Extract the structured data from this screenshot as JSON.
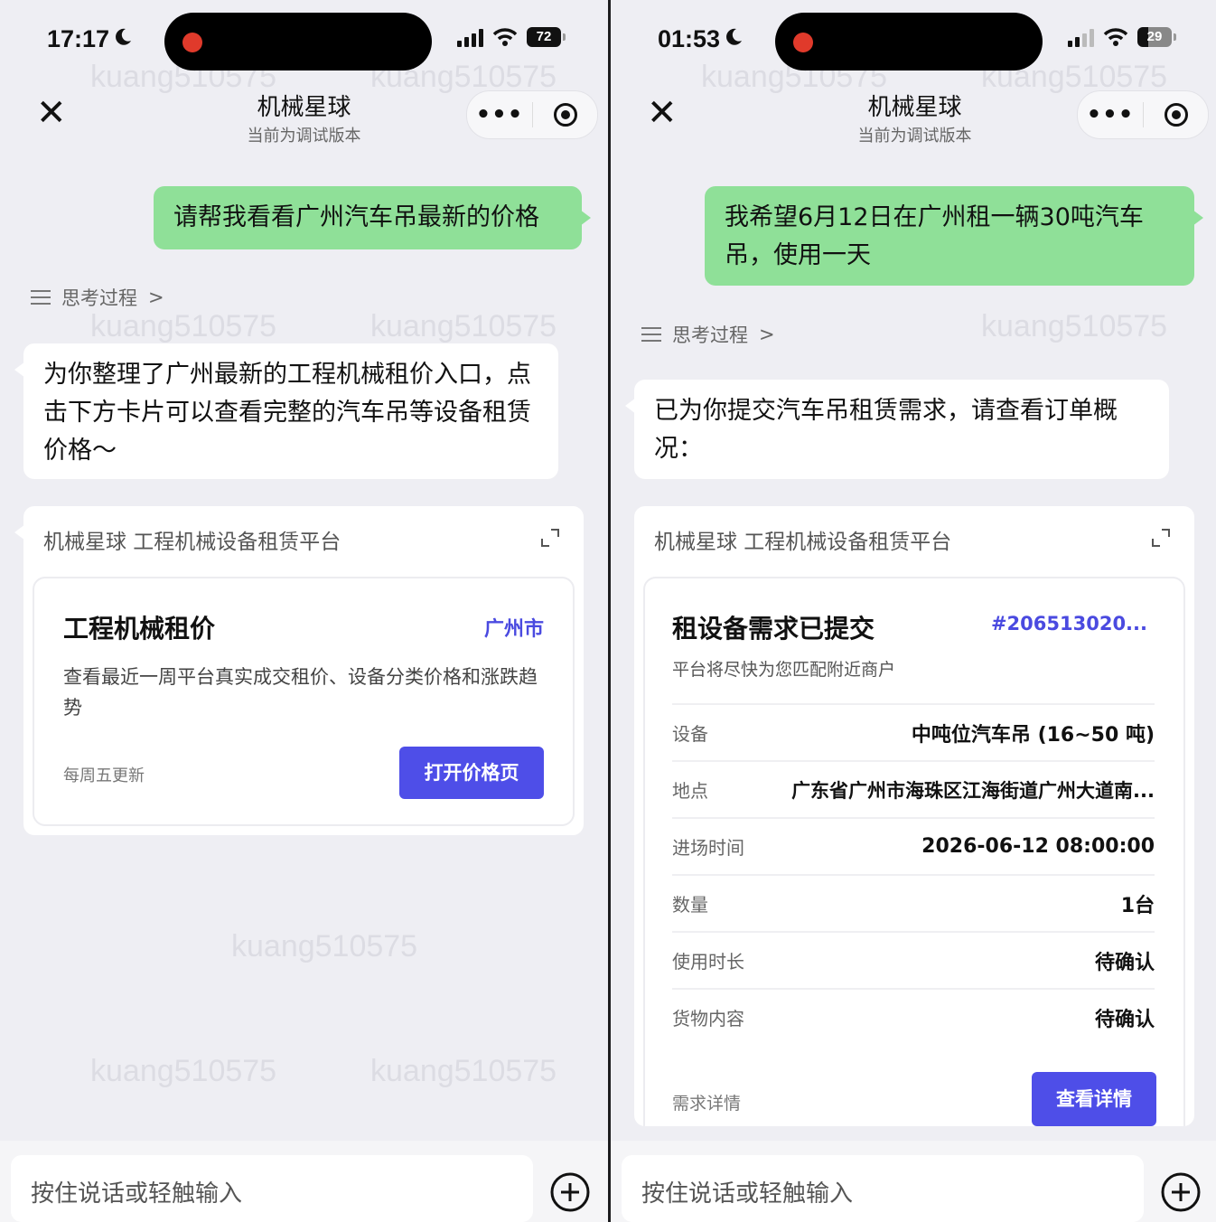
{
  "watermark": "kuang510575",
  "app": {
    "title": "机械星球",
    "subtitle": "当前为调试版本",
    "thinking_label": "思考过程",
    "thinking_chevron": ">",
    "card_header": "机械星球 工程机械设备租赁平台",
    "input_placeholder": "按住说话或轻触输入",
    "more_icon": "•••"
  },
  "left": {
    "status": {
      "time": "17:17",
      "battery": "72"
    },
    "user_message": "请帮我看看广州汽车吊最新的价格",
    "bot_message": "为你整理了广州最新的工程机械租价入口，点击下方卡片可以查看完整的汽车吊等设备租赁价格～",
    "card": {
      "title": "工程机械租价",
      "city": "广州市",
      "description": "查看最近一周平台真实成交租价、设备分类价格和涨跌趋势",
      "update_note": "每周五更新",
      "button": "打开价格页"
    }
  },
  "right": {
    "status": {
      "time": "01:53",
      "battery": "29"
    },
    "user_message": "我希望6月12日在广州租一辆30吨汽车吊，使用一天",
    "bot_message": "已为你提交汽车吊租赁需求，请查看订单概况：",
    "card": {
      "title": "租设备需求已提交",
      "order_id": "#206513020...",
      "subtitle": "平台将尽快为您匹配附近商户",
      "rows": [
        {
          "label": "设备",
          "value": "中吨位汽车吊 (16~50 吨)"
        },
        {
          "label": "地点",
          "value": "广东省广州市海珠区江海街道广州大道南..."
        },
        {
          "label": "进场时间",
          "value": "2026-06-12 08:00:00"
        },
        {
          "label": "数量",
          "value": "1台"
        },
        {
          "label": "使用时长",
          "value": "待确认"
        },
        {
          "label": "货物内容",
          "value": "待确认"
        }
      ],
      "footer_label": "需求详情",
      "button": "查看详情"
    }
  },
  "colors": {
    "user_bubble": "#8fe098",
    "accent": "#4e4ee8",
    "recording_dot": "#e03a2b"
  },
  "icons": [
    "close-icon",
    "more-icon",
    "record-icon",
    "menu-icon",
    "chevron-right-icon",
    "expand-icon",
    "plus-icon",
    "moon-icon",
    "signal-icon",
    "wifi-icon",
    "battery-icon"
  ]
}
